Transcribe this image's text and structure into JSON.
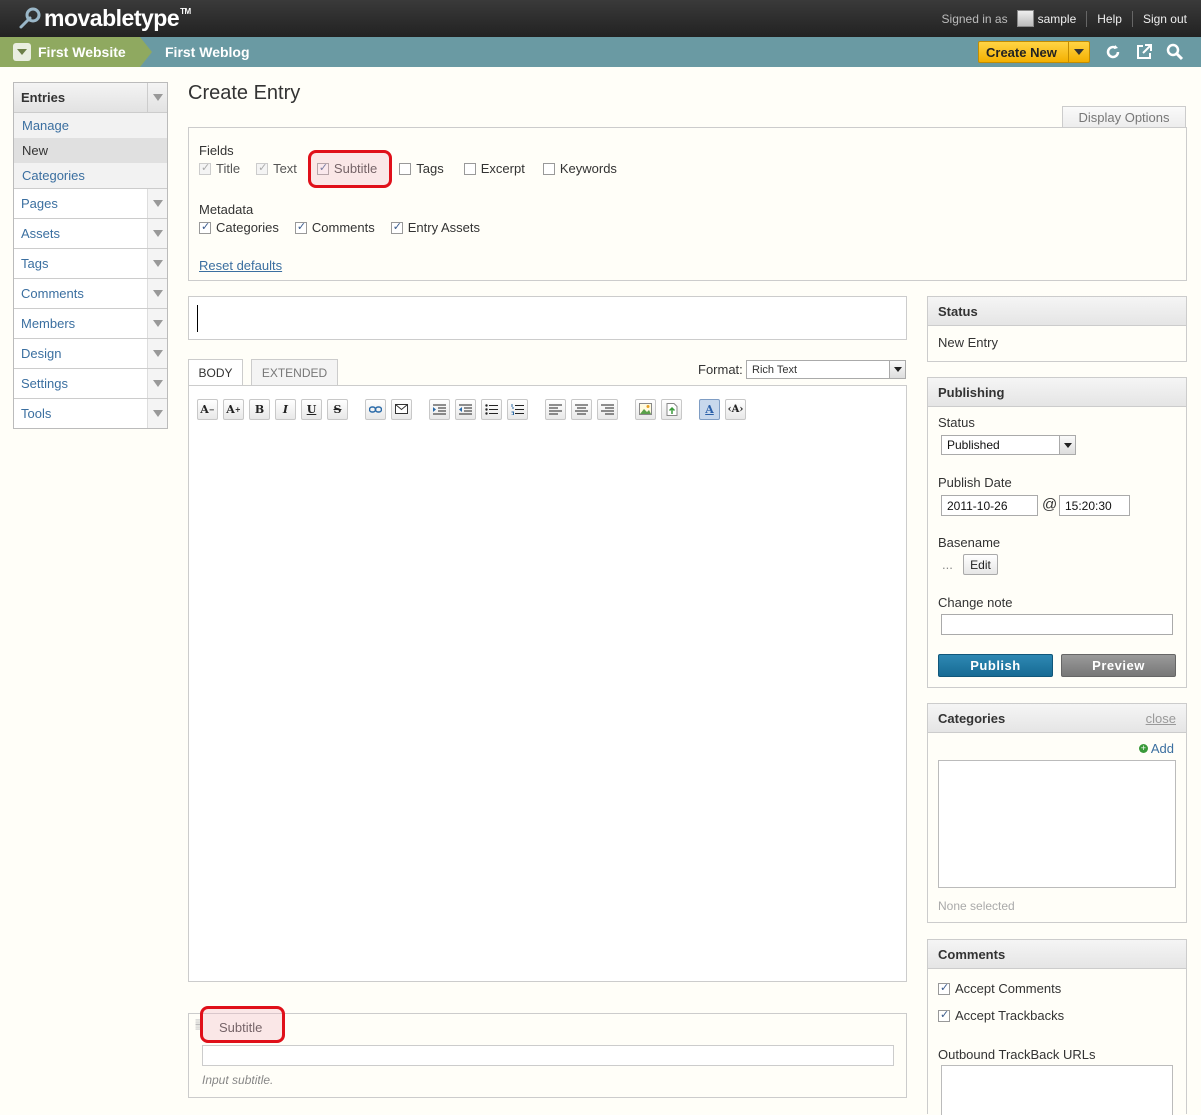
{
  "topbar": {
    "logo_text": "movabletype",
    "logo_tm": "TM",
    "signed_in_label": "Signed in as",
    "username": "sample",
    "help": "Help",
    "sign_out": "Sign out"
  },
  "navbar": {
    "website": "First Website",
    "blog": "First Weblog",
    "create_new": "Create New"
  },
  "sidebar": {
    "entries": {
      "label": "Entries",
      "sub": [
        "Manage",
        "New",
        "Categories"
      ],
      "active": "New"
    },
    "items": [
      "Pages",
      "Assets",
      "Tags",
      "Comments",
      "Members",
      "Design",
      "Settings",
      "Tools"
    ]
  },
  "main": {
    "title": "Create Entry",
    "display_options": "Display Options",
    "fields_label": "Fields",
    "fields": [
      {
        "label": "Title",
        "checked": true,
        "disabled": true
      },
      {
        "label": "Text",
        "checked": true,
        "disabled": true
      },
      {
        "label": "Subtitle",
        "checked": true,
        "disabled": false
      },
      {
        "label": "Tags",
        "checked": false,
        "disabled": false
      },
      {
        "label": "Excerpt",
        "checked": false,
        "disabled": false
      },
      {
        "label": "Keywords",
        "checked": false,
        "disabled": false
      }
    ],
    "metadata_label": "Metadata",
    "metadata": [
      {
        "label": "Categories",
        "checked": true
      },
      {
        "label": "Comments",
        "checked": true
      },
      {
        "label": "Entry Assets",
        "checked": true
      }
    ],
    "reset_defaults": "Reset defaults",
    "tabs": {
      "body": "BODY",
      "extended": "EXTENDED"
    },
    "format_label": "Format:",
    "format_value": "Rich Text",
    "subtitle": {
      "label": "Subtitle",
      "hint": "Input subtitle."
    }
  },
  "status_widget": {
    "title": "Status",
    "value": "New Entry"
  },
  "publishing": {
    "title": "Publishing",
    "status_label": "Status",
    "status_value": "Published",
    "date_label": "Publish Date",
    "date_value": "2011-10-26",
    "at": "@",
    "time_value": "15:20:30",
    "basename_label": "Basename",
    "basename_value": "...",
    "edit": "Edit",
    "change_note_label": "Change note",
    "publish": "Publish",
    "preview": "Preview"
  },
  "categories_widget": {
    "title": "Categories",
    "close": "close",
    "add": "Add",
    "none_selected": "None selected"
  },
  "comments_widget": {
    "title": "Comments",
    "accept_comments": "Accept Comments",
    "accept_trackbacks": "Accept Trackbacks",
    "outbound_label": "Outbound TrackBack URLs"
  },
  "colors": {
    "accent_red": "#e0101a",
    "nav_teal": "#6a9aa3",
    "website_green": "#8fa960",
    "create_yellow": "#f4b000"
  }
}
